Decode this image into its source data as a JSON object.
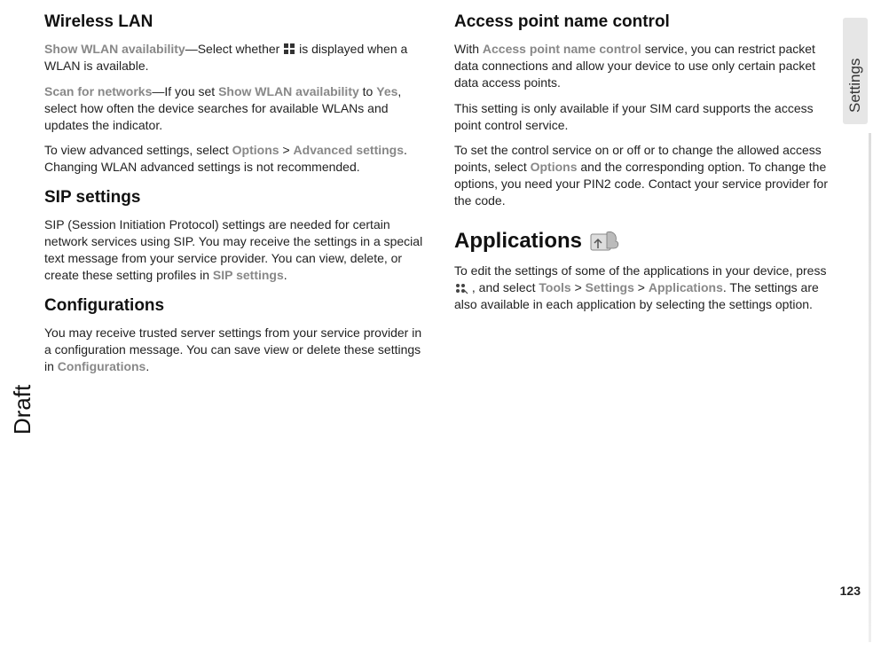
{
  "side_tab": "Settings",
  "side_draft": "Draft",
  "page_number": "123",
  "left": {
    "wlan_heading": "Wireless LAN",
    "wlan_p1_a": "Show WLAN availability",
    "wlan_p1_b": "—Select whether ",
    "wlan_p1_c": " is displayed when a WLAN is available.",
    "wlan_p2_a": "Scan for networks",
    "wlan_p2_b": "—If you set ",
    "wlan_p2_c": "Show WLAN availability",
    "wlan_p2_d": " to ",
    "wlan_p2_e": "Yes",
    "wlan_p2_f": ", select how often the device searches for available WLANs and updates the indicator.",
    "wlan_p3_a": "To view advanced settings, select ",
    "wlan_p3_b": "Options",
    "wlan_p3_c": " > ",
    "wlan_p3_d": "Advanced settings",
    "wlan_p3_e": ". Changing WLAN advanced settings is not recommended.",
    "sip_heading": "SIP settings",
    "sip_p1_a": "SIP (Session Initiation Protocol) settings are needed for certain network services using SIP. You may receive the settings in a special text message from your service provider. You can view, delete, or create these setting profiles in ",
    "sip_p1_b": "SIP settings",
    "sip_p1_c": ".",
    "conf_heading": "Configurations",
    "conf_p1_a": "You may receive trusted server settings from your service provider in a configuration message. You can save view or delete these settings in ",
    "conf_p1_b": "Configurations",
    "conf_p1_c": "."
  },
  "right": {
    "apn_heading": "Access point name control",
    "apn_p1_a": "With ",
    "apn_p1_b": "Access point name control",
    "apn_p1_c": " service, you can restrict packet data connections and allow your device to use only certain packet data access points.",
    "apn_p2": "This setting is only available if your SIM card supports the access point control service.",
    "apn_p3_a": "To set the control service on or off or to change the allowed access points, select ",
    "apn_p3_b": "Options",
    "apn_p3_c": " and the corresponding option. To change the options, you need your PIN2 code. Contact your service provider for the code.",
    "apps_heading": "Applications",
    "apps_p1_a": "To edit the settings of some of the applications in your device, press ",
    "apps_p1_b": " , and select ",
    "apps_p1_c": "Tools",
    "apps_p1_d": " > ",
    "apps_p1_e": "Settings",
    "apps_p1_f": " > ",
    "apps_p1_g": "Applications",
    "apps_p1_h": ". The settings are also available in each application by selecting the settings option."
  }
}
